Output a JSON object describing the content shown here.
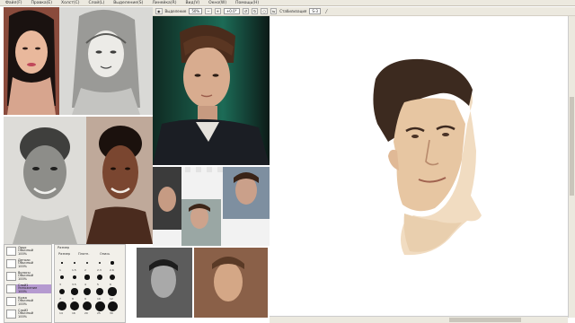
{
  "menu": {
    "items": [
      "Файл(F)",
      "Правка(E)",
      "Холст(C)",
      "Слой(L)",
      "Выделение(S)",
      "Линейка(R)",
      "Вид(V)",
      "Окно(W)",
      "Помощь(H)"
    ]
  },
  "toolbar": {
    "selection_label": "Выделение",
    "zoom_value": "50%",
    "rotation_value": "+0.0°",
    "stabilizer_label": "Стабилизация",
    "stabilizer_value": "S-3"
  },
  "layers_panel": {
    "items": [
      {
        "name": "Лицо",
        "mode": "Обычный",
        "opacity": "100%"
      },
      {
        "name": "Детали",
        "mode": "Обычный",
        "opacity": "100%"
      },
      {
        "name": "Волосы",
        "mode": "Обычный",
        "opacity": "100%"
      },
      {
        "name": "Слой1",
        "mode": "Умножение",
        "opacity": "100%"
      },
      {
        "name": "Кожа",
        "mode": "Обычный",
        "opacity": "100%"
      },
      {
        "name": "Слой2",
        "mode": "Обычный",
        "opacity": "100%"
      }
    ]
  },
  "brush_panel": {
    "title": "Размер",
    "options": [
      "Размер",
      "Плотн.",
      "Опись"
    ],
    "sizes": [
      "1",
      "1.5",
      "2",
      "2.3",
      "2.6",
      "3",
      "3.5",
      "4",
      "5",
      "6",
      "7",
      "8",
      "9",
      "10",
      "12",
      "14",
      "16",
      "20",
      "25",
      "30"
    ]
  },
  "icons": {
    "selection": "selection-icon",
    "rotate_left": "rotate-left-icon",
    "rotate_right": "rotate-right-icon",
    "flip": "flip-icon",
    "pen": "pen-icon"
  },
  "colors": {
    "ui_bg": "#ece9df",
    "selected_layer": "#b59ad0",
    "canvas": "#ffffff"
  }
}
